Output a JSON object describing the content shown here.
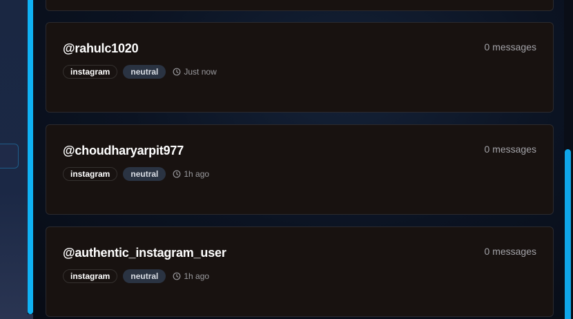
{
  "cards": [
    {
      "username": "@rahulc1020",
      "message_count": "0 messages",
      "platform": "instagram",
      "sentiment": "neutral",
      "time": "Just now"
    },
    {
      "username": "@choudharyarpit977",
      "message_count": "0 messages",
      "platform": "instagram",
      "sentiment": "neutral",
      "time": "1h ago"
    },
    {
      "username": "@authentic_instagram_user",
      "message_count": "0 messages",
      "platform": "instagram",
      "sentiment": "neutral",
      "time": "1h ago"
    }
  ],
  "colors": {
    "accent": "#0fb2f5",
    "card_background": "#181210",
    "badge_sentiment_bg": "#2a3342"
  }
}
